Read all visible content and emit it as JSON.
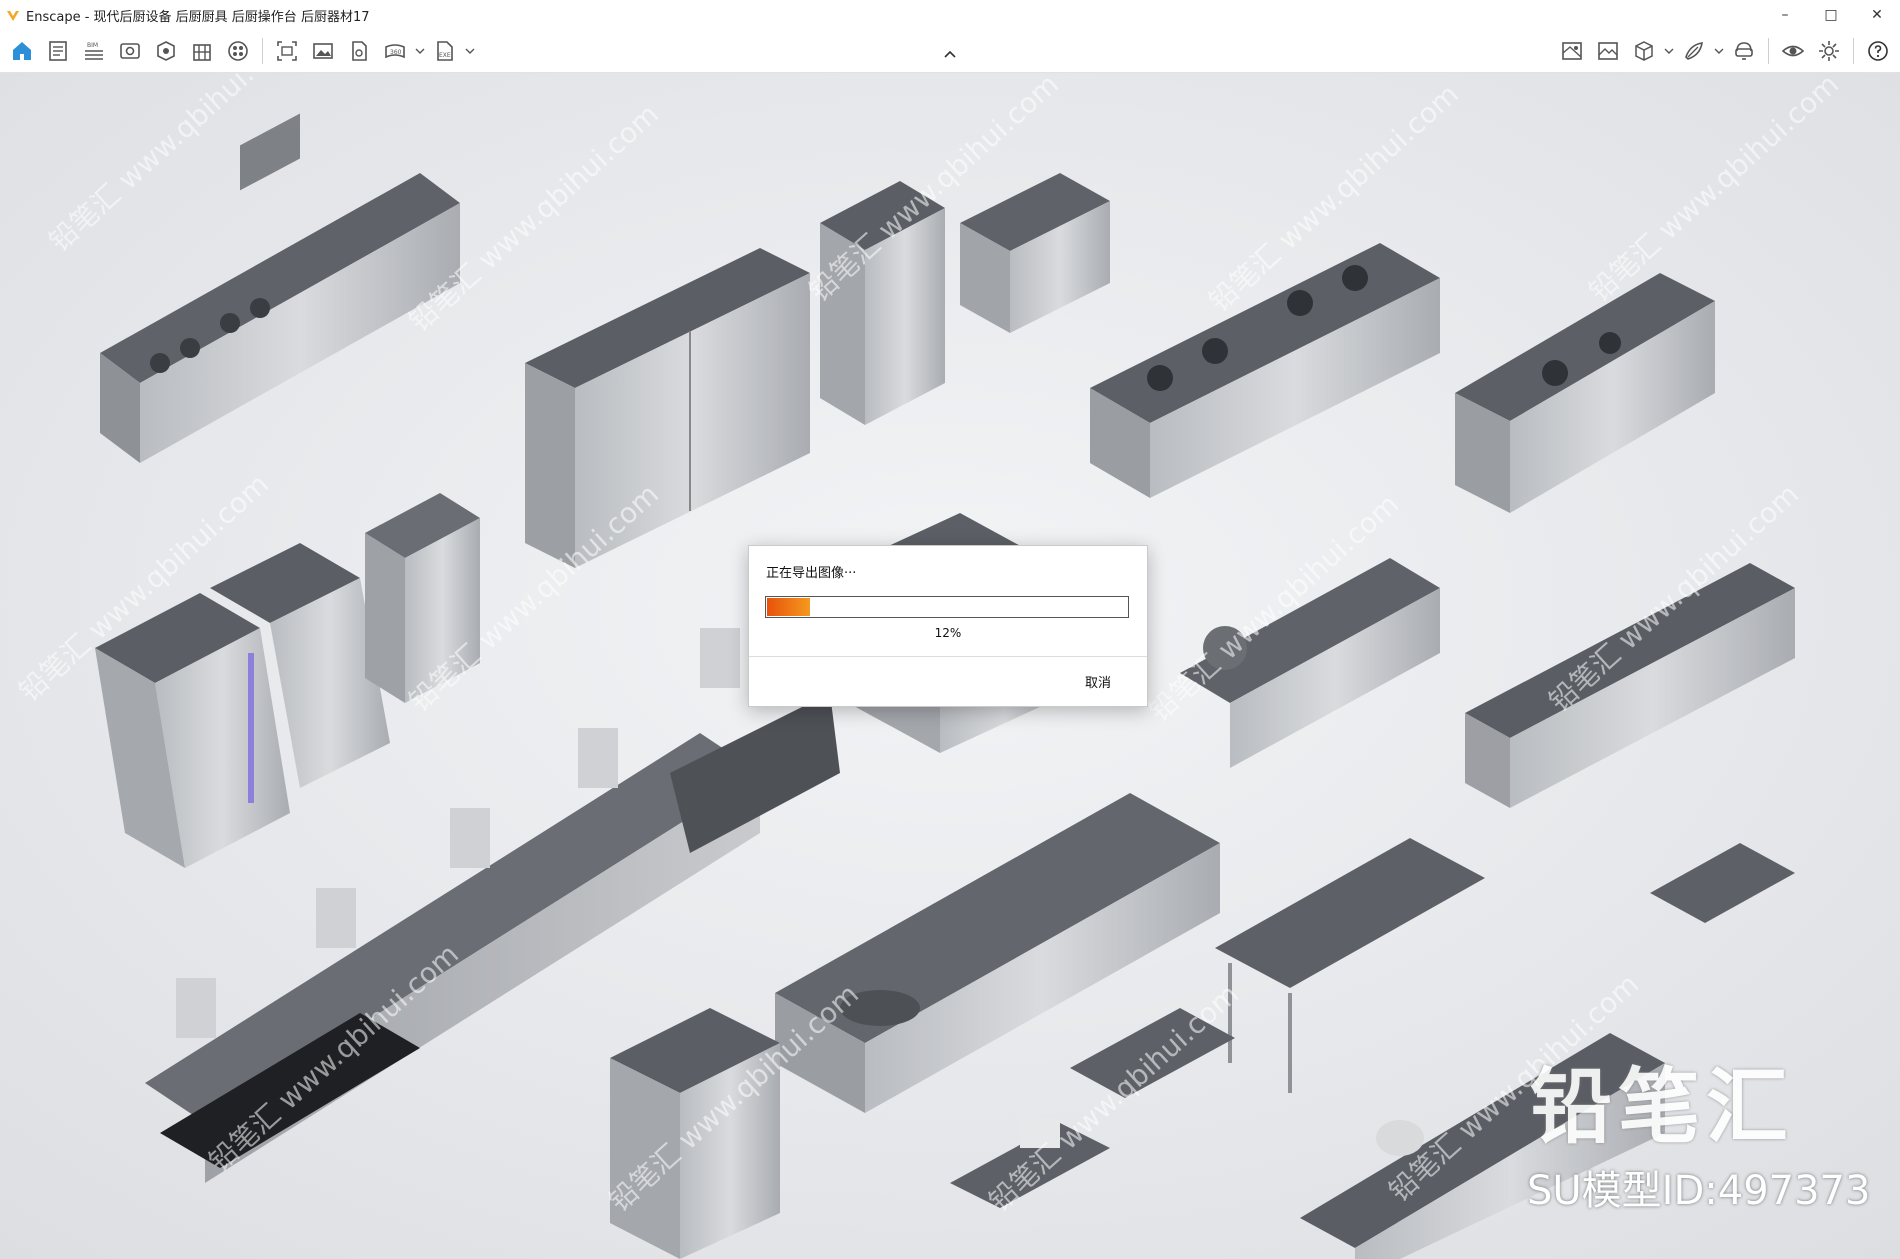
{
  "window": {
    "title": "Enscape - 现代后厨设备 后厨厨具 后厨操作台 后厨器材17",
    "controls": {
      "minimize": "–",
      "maximize": "□",
      "close": "✕"
    },
    "accent_color": "#f5a623"
  },
  "toolbar": {
    "left_icons": [
      "home-icon",
      "document-icon",
      "bim-icon",
      "view-icon",
      "capture-icon",
      "site-icon",
      "materials-icon",
      "screenshot-icon",
      "image-icon",
      "render-icon",
      "panorama-icon",
      "export-icon"
    ],
    "bim_label": "BIM",
    "panorama_label": "360",
    "export_label": "EXE",
    "right_icons": [
      "map-icon",
      "landscape-icon",
      "cube-icon",
      "atmosphere-icon",
      "vr-icon",
      "visibility-icon",
      "settings-icon",
      "help-icon"
    ]
  },
  "dialog": {
    "title": "正在导出图像···",
    "progress": 0.12,
    "progress_label": "12%",
    "cancel_label": "取消",
    "progress_color_start": "#e8520b",
    "progress_color_end": "#f39a20"
  },
  "watermark": {
    "brand": "铅笔汇",
    "model_id": "SU模型ID:497373",
    "tile_text": "铅笔汇 www.qbihui.com"
  }
}
